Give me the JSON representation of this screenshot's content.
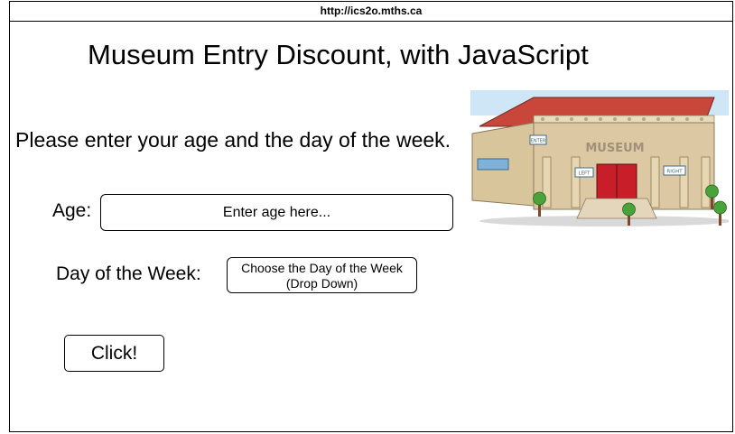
{
  "browser": {
    "url": "http://ics2o.mths.ca"
  },
  "page": {
    "title": "Museum Entry Discount, with JavaScript",
    "prompt": "Please enter your age and the day of the week."
  },
  "form": {
    "age_label": "Age:",
    "age_placeholder": "Enter age here...",
    "day_label": "Day of the Week:",
    "day_select_line1": "Choose the Day of the Week",
    "day_select_line2": "(Drop Down)",
    "button_label": "Click!"
  },
  "illustration": {
    "sign_text": "MUSEUM",
    "enter_sign": "ENTER",
    "left_sign": "LEFT",
    "right_sign": "RIGHT",
    "colors": {
      "roof": "#c8473a",
      "stone": "#dcc9a4",
      "door": "#c81e2a",
      "sky": "#cfe6f7",
      "tree": "#4aa23a"
    }
  }
}
